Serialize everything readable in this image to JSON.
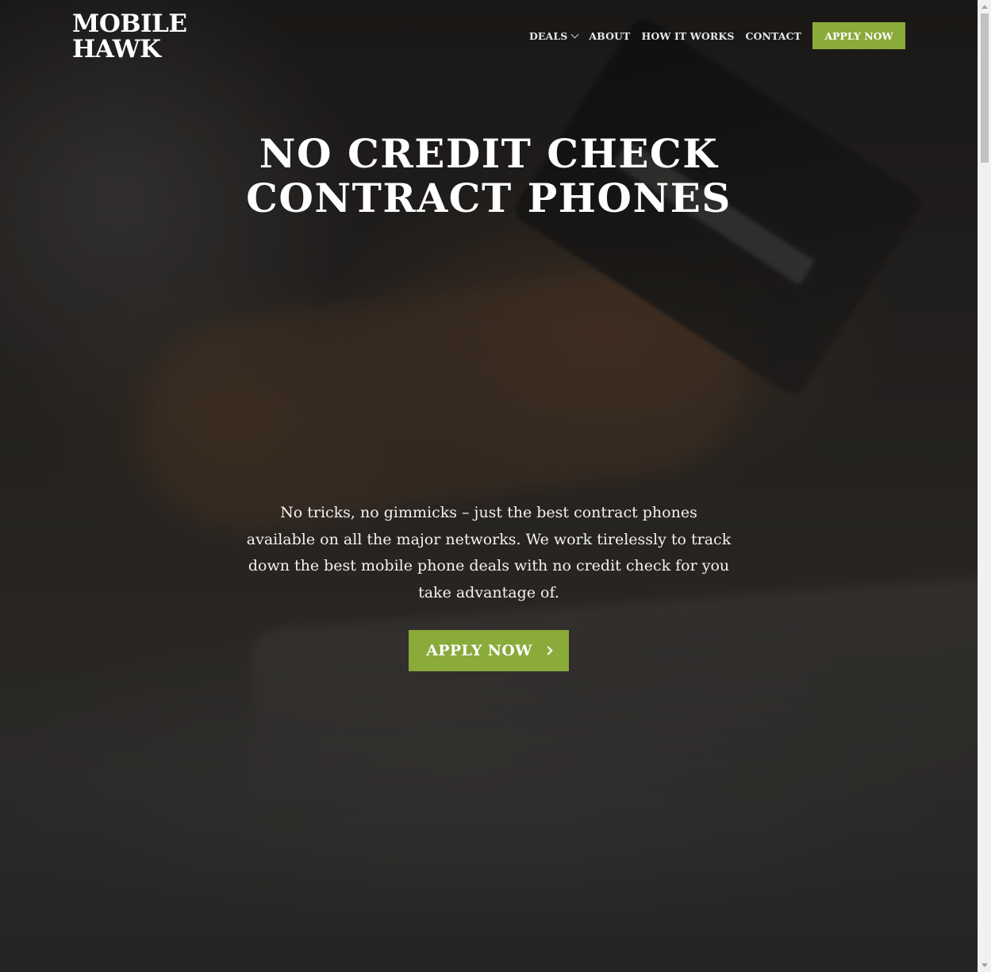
{
  "header": {
    "logo_line1": "MOBILE",
    "logo_line2": "HAWK",
    "nav": {
      "deals": "DEALS",
      "about": "ABOUT",
      "how_it_works": "HOW IT WORKS",
      "contact": "CONTACT",
      "apply_now": "APPLY NOW"
    }
  },
  "hero": {
    "headline_line1": "NO CREDIT CHECK",
    "headline_line2": "CONTRACT PHONES",
    "description": "No tricks, no gimmicks – just the best contract phones available on all the major networks. We work tirelessly to track down the best mobile phone deals with no credit check for you take advantage of.",
    "cta_label": "APPLY NOW"
  },
  "colors": {
    "accent": "#8aaa3a",
    "text": "#ffffff",
    "background": "#2b2a28"
  },
  "icons": {
    "deals_dropdown": "chevron-down-icon",
    "cta_arrow": "chevron-right-icon"
  }
}
